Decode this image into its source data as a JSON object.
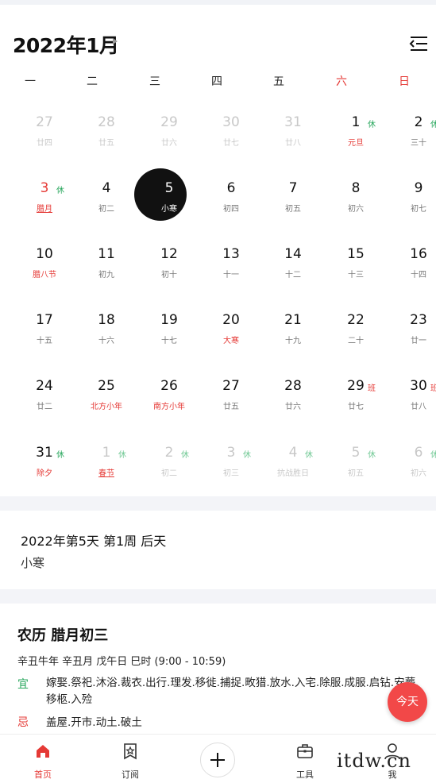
{
  "header": {
    "title": "2022年1月"
  },
  "weekdays": [
    "一",
    "二",
    "三",
    "四",
    "五",
    "六",
    "日"
  ],
  "weeks": [
    [
      {
        "num": "27",
        "sub": "廿四",
        "dim": true
      },
      {
        "num": "28",
        "sub": "廿五",
        "dim": true
      },
      {
        "num": "29",
        "sub": "廿六",
        "dim": true
      },
      {
        "num": "30",
        "sub": "廿七",
        "dim": true
      },
      {
        "num": "31",
        "sub": "廿八",
        "dim": true
      },
      {
        "num": "1",
        "sub": "元旦",
        "badge": "休",
        "subRed": true
      },
      {
        "num": "2",
        "sub": "三十",
        "badge": "休"
      }
    ],
    [
      {
        "num": "3",
        "sub": "腊月",
        "badge": "休",
        "numRed": true,
        "subRed": true,
        "under": true
      },
      {
        "num": "4",
        "sub": "初二"
      },
      {
        "num": "5",
        "sub": "小寒",
        "selected": true
      },
      {
        "num": "6",
        "sub": "初四"
      },
      {
        "num": "7",
        "sub": "初五"
      },
      {
        "num": "8",
        "sub": "初六"
      },
      {
        "num": "9",
        "sub": "初七"
      }
    ],
    [
      {
        "num": "10",
        "sub": "腊八节",
        "subRed": true
      },
      {
        "num": "11",
        "sub": "初九"
      },
      {
        "num": "12",
        "sub": "初十"
      },
      {
        "num": "13",
        "sub": "十一"
      },
      {
        "num": "14",
        "sub": "十二"
      },
      {
        "num": "15",
        "sub": "十三"
      },
      {
        "num": "16",
        "sub": "十四"
      }
    ],
    [
      {
        "num": "17",
        "sub": "十五"
      },
      {
        "num": "18",
        "sub": "十六"
      },
      {
        "num": "19",
        "sub": "十七"
      },
      {
        "num": "20",
        "sub": "大寒",
        "subRed": true
      },
      {
        "num": "21",
        "sub": "十九"
      },
      {
        "num": "22",
        "sub": "二十"
      },
      {
        "num": "23",
        "sub": "廿一"
      }
    ],
    [
      {
        "num": "24",
        "sub": "廿二"
      },
      {
        "num": "25",
        "sub": "北方小年",
        "subRed": true
      },
      {
        "num": "26",
        "sub": "南方小年",
        "subRed": true
      },
      {
        "num": "27",
        "sub": "廿五"
      },
      {
        "num": "28",
        "sub": "廿六"
      },
      {
        "num": "29",
        "sub": "廿七",
        "badge": "班",
        "badgeRed": true
      },
      {
        "num": "30",
        "sub": "廿八",
        "badge": "班",
        "badgeRed": true
      }
    ],
    [
      {
        "num": "31",
        "sub": "除夕",
        "badge": "休",
        "subRed": true
      },
      {
        "num": "1",
        "sub": "春节",
        "badge": "休",
        "dim": true,
        "subRed": true,
        "under": true
      },
      {
        "num": "2",
        "sub": "初二",
        "badge": "休",
        "dim": true
      },
      {
        "num": "3",
        "sub": "初三",
        "badge": "休",
        "dim": true
      },
      {
        "num": "4",
        "sub": "抗战胜日",
        "badge": "休",
        "dim": true
      },
      {
        "num": "5",
        "sub": "初五",
        "badge": "休",
        "dim": true
      },
      {
        "num": "6",
        "sub": "初六",
        "badge": "休",
        "dim": true
      }
    ]
  ],
  "info": {
    "line1": "2022年第5天 第1周 后天",
    "line2": "小寒"
  },
  "almanac": {
    "title": "农历 腊月初三",
    "ganzhi": "辛丑牛年 辛丑月 戊午日 巳时 (9:00 - 10:59)",
    "yi_label": "宜",
    "yi_text": "嫁娶.祭祀.沐浴.裁衣.出行.理发.移徙.捕捉.畋猎.放水.入宅.除服.成服.启钻.安葬.移柩.入殓",
    "ji_label": "忌",
    "ji_text": "盖屋.开市.动土.破土"
  },
  "today_button": "今天",
  "nav": {
    "home": "首页",
    "subscribe": "订阅",
    "tools": "工具",
    "me": "我"
  },
  "watermark": "itdw.cn",
  "colors": {
    "accent": "#e53935",
    "rest_badge": "#26a65b",
    "selected": "#111111"
  }
}
